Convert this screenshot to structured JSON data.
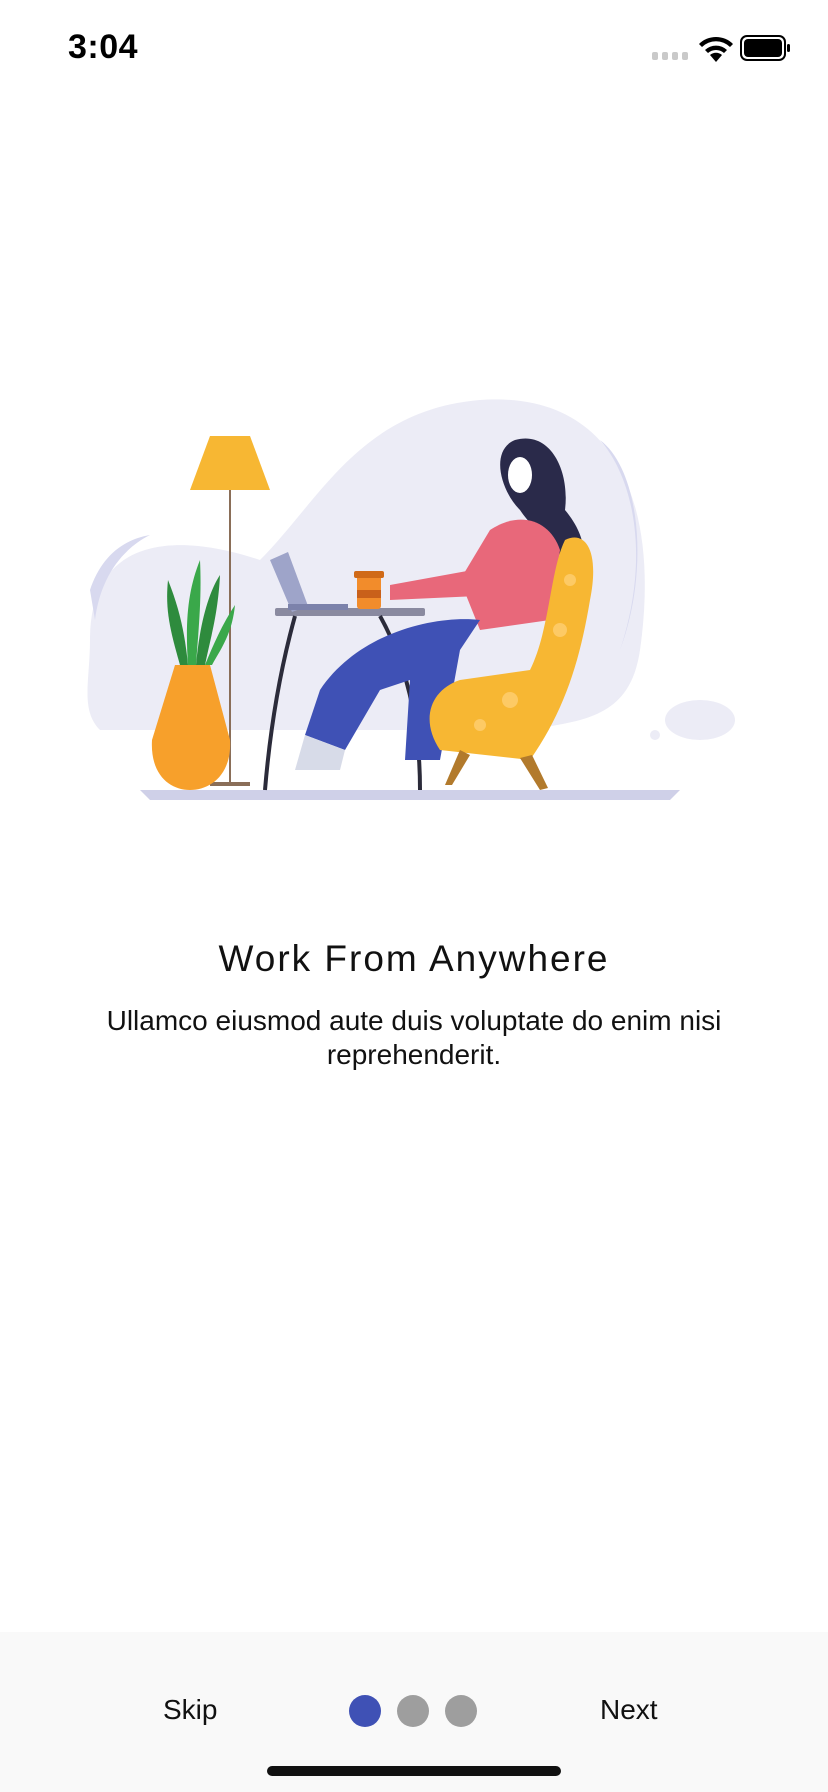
{
  "status": {
    "time": "3:04"
  },
  "onboarding": {
    "title": "Work From Anywhere",
    "subtitle": "Ullamco eiusmod aute duis voluptate do enim nisi reprehenderit."
  },
  "nav": {
    "skip_label": "Skip",
    "next_label": "Next",
    "pages_total": 3,
    "current_page": 1
  },
  "colors": {
    "accent": "#3f51b5",
    "dot_inactive": "#9e9e9e",
    "chair": "#f7b733",
    "pants": "#3f51b5",
    "shirt": "#e8687a"
  },
  "icons": [
    "cellular-signal-icon",
    "wifi-icon",
    "battery-icon"
  ]
}
